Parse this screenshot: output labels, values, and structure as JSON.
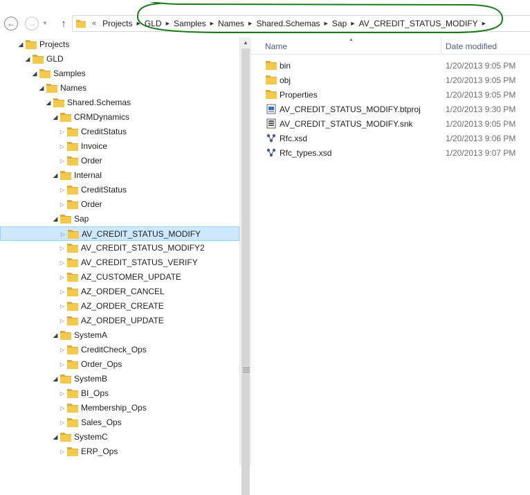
{
  "address": {
    "overflow": "«",
    "crumbs": [
      "Projects",
      "GLD",
      "Samples",
      "Names",
      "Shared.Schemas",
      "Sap",
      "AV_CREDIT_STATUS_MODIFY"
    ],
    "back_icon": "back-arrow-icon",
    "forward_icon": "forward-arrow-icon",
    "up_icon": "up-arrow-icon",
    "highlight_color": "#1a7a1a"
  },
  "tree": [
    {
      "label": "Projects",
      "level": 0,
      "expanded": true
    },
    {
      "label": "GLD",
      "level": 1,
      "expanded": true
    },
    {
      "label": "Samples",
      "level": 2,
      "expanded": true
    },
    {
      "label": "Names",
      "level": 3,
      "expanded": true
    },
    {
      "label": "Shared.Schemas",
      "level": 4,
      "expanded": true
    },
    {
      "label": "CRMDynamics",
      "level": 5,
      "expanded": true
    },
    {
      "label": "CreditStatus",
      "level": 6,
      "expanded": false
    },
    {
      "label": "Invoice",
      "level": 6,
      "expanded": false
    },
    {
      "label": "Order",
      "level": 6,
      "expanded": false
    },
    {
      "label": "Internal",
      "level": 5,
      "expanded": true
    },
    {
      "label": "CreditStatus",
      "level": 6,
      "expanded": false
    },
    {
      "label": "Order",
      "level": 6,
      "expanded": false
    },
    {
      "label": "Sap",
      "level": 5,
      "expanded": true
    },
    {
      "label": "AV_CREDIT_STATUS_MODIFY",
      "level": 6,
      "expanded": false,
      "selected": true
    },
    {
      "label": "AV_CREDIT_STATUS_MODIFY2",
      "level": 6,
      "expanded": false
    },
    {
      "label": "AV_CREDIT_STATUS_VERIFY",
      "level": 6,
      "expanded": false
    },
    {
      "label": "AZ_CUSTOMER_UPDATE",
      "level": 6,
      "expanded": false
    },
    {
      "label": "AZ_ORDER_CANCEL",
      "level": 6,
      "expanded": false
    },
    {
      "label": "AZ_ORDER_CREATE",
      "level": 6,
      "expanded": false
    },
    {
      "label": "AZ_ORDER_UPDATE",
      "level": 6,
      "expanded": false
    },
    {
      "label": "SystemA",
      "level": 5,
      "expanded": true
    },
    {
      "label": "CreditCheck_Ops",
      "level": 6,
      "expanded": false
    },
    {
      "label": "Order_Ops",
      "level": 6,
      "expanded": false
    },
    {
      "label": "SystemB",
      "level": 5,
      "expanded": true
    },
    {
      "label": "BI_Ops",
      "level": 6,
      "expanded": false
    },
    {
      "label": "Membership_Ops",
      "level": 6,
      "expanded": false
    },
    {
      "label": "Sales_Ops",
      "level": 6,
      "expanded": false
    },
    {
      "label": "SystemC",
      "level": 5,
      "expanded": true
    },
    {
      "label": "ERP_Ops",
      "level": 6,
      "expanded": false
    }
  ],
  "columns": {
    "name": "Name",
    "date": "Date modified"
  },
  "files": [
    {
      "name": "bin",
      "date": "1/20/2013 9:05 PM",
      "icon": "folder-icon"
    },
    {
      "name": "obj",
      "date": "1/20/2013 9:05 PM",
      "icon": "folder-icon"
    },
    {
      "name": "Properties",
      "date": "1/20/2013 9:05 PM",
      "icon": "folder-icon"
    },
    {
      "name": "AV_CREDIT_STATUS_MODIFY.btproj",
      "date": "1/20/2013 9:30 PM",
      "icon": "project-file-icon"
    },
    {
      "name": "AV_CREDIT_STATUS_MODIFY.snk",
      "date": "1/20/2013 9:05 PM",
      "icon": "key-file-icon"
    },
    {
      "name": "Rfc.xsd",
      "date": "1/20/2013 9:06 PM",
      "icon": "schema-file-icon"
    },
    {
      "name": "Rfc_types.xsd",
      "date": "1/20/2013 9:07 PM",
      "icon": "schema-file-icon"
    }
  ],
  "colors": {
    "folder": "#f3c94c",
    "folder_dark": "#dca93a",
    "selection": "#cde8ff",
    "selection_border": "#99d1ff"
  }
}
